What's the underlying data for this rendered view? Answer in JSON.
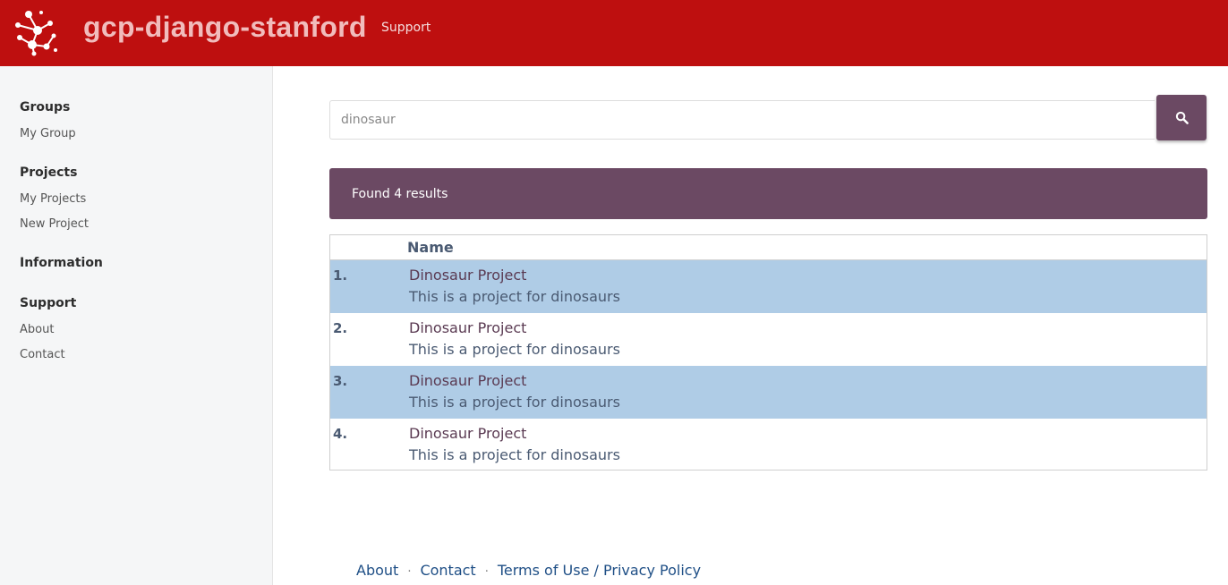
{
  "header": {
    "title": "gcp-django-stanford",
    "nav_support": "Support",
    "brand_color": "#be0f0f"
  },
  "sidebar": {
    "sections": [
      {
        "heading": "Groups",
        "links": [
          "My Group"
        ]
      },
      {
        "heading": "Projects",
        "links": [
          "My Projects",
          "New Project"
        ]
      },
      {
        "heading": "Information",
        "links": []
      },
      {
        "heading": "Support",
        "links": [
          "About",
          "Contact"
        ]
      }
    ]
  },
  "search": {
    "value": "dinosaur",
    "button_icon": "search-icon",
    "accent_color": "#6b4963"
  },
  "results": {
    "summary": "Found 4 results",
    "column_name": "Name",
    "rows": [
      {
        "num": "1.",
        "title": "Dinosaur Project",
        "description": "This is a project for dinosaurs"
      },
      {
        "num": "2.",
        "title": "Dinosaur Project",
        "description": "This is a project for dinosaurs"
      },
      {
        "num": "3.",
        "title": "Dinosaur Project",
        "description": "This is a project for dinosaurs"
      },
      {
        "num": "4.",
        "title": "Dinosaur Project",
        "description": "This is a project for dinosaurs"
      }
    ],
    "row_highlight_color": "#afcce6"
  },
  "footer": {
    "about": "About",
    "contact": "Contact",
    "terms": "Terms of Use / Privacy Policy",
    "separator": "·"
  }
}
